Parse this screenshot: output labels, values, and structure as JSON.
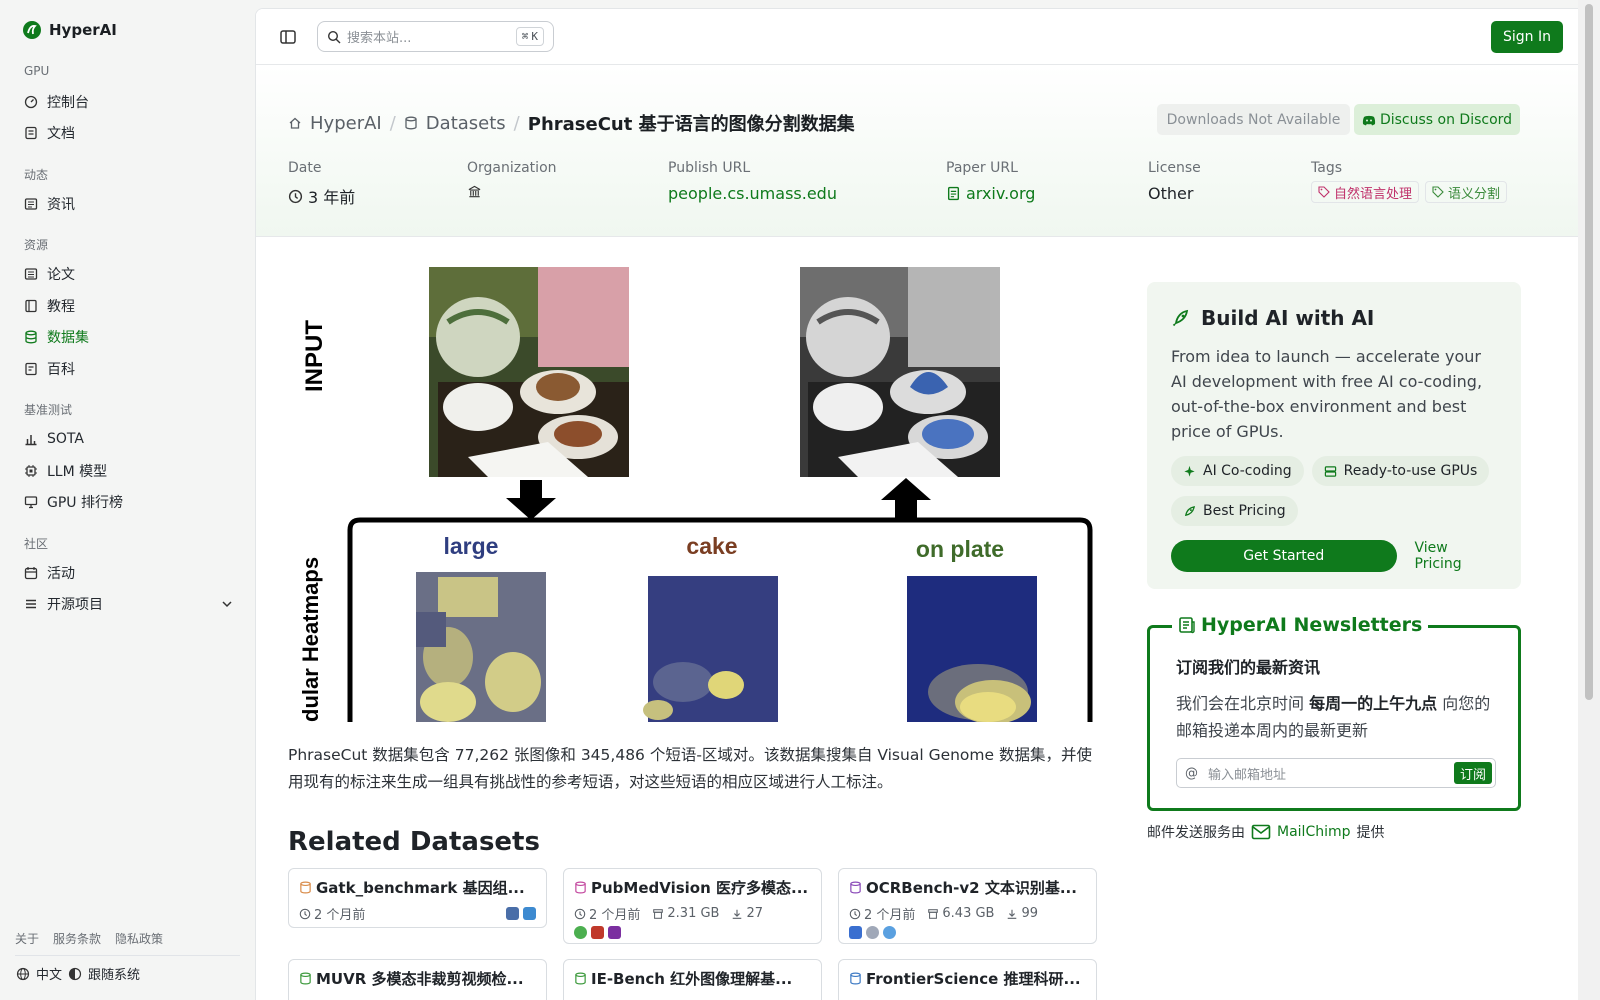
{
  "brand": {
    "name": "HyperAI"
  },
  "sidebar": {
    "sections": [
      {
        "title": "GPU",
        "items": [
          {
            "label": "控制台",
            "icon": "dashboard-icon"
          },
          {
            "label": "文档",
            "icon": "doc-icon"
          }
        ]
      },
      {
        "title": "动态",
        "items": [
          {
            "label": "资讯",
            "icon": "news-icon"
          }
        ]
      },
      {
        "title": "资源",
        "items": [
          {
            "label": "论文",
            "icon": "paper-icon"
          },
          {
            "label": "教程",
            "icon": "book-icon"
          },
          {
            "label": "数据集",
            "icon": "database-icon",
            "active": true
          },
          {
            "label": "百科",
            "icon": "wiki-icon"
          }
        ]
      },
      {
        "title": "基准测试",
        "items": [
          {
            "label": "SOTA",
            "icon": "chart-icon"
          },
          {
            "label": "LLM 模型",
            "icon": "chip-icon"
          },
          {
            "label": "GPU 排行榜",
            "icon": "monitor-icon"
          }
        ]
      },
      {
        "title": "社区",
        "items": [
          {
            "label": "活动",
            "icon": "event-icon"
          },
          {
            "label": "开源项目",
            "icon": "list-icon"
          }
        ]
      }
    ],
    "footer_links": [
      "关于",
      "服务条款",
      "隐私政策"
    ],
    "language": "中文",
    "tracking": "跟随系统"
  },
  "topbar": {
    "search_placeholder": "搜索本站...",
    "shortcut": "K",
    "signin": "Sign In"
  },
  "header": {
    "breadcrumbs": [
      "HyperAI",
      "Datasets"
    ],
    "title_en": "PhraseCut",
    "title_cn": "基于语言的图像分割数据集",
    "downloads": "Downloads Not Available",
    "discord": "Discuss on Discord",
    "meta": {
      "date_label": "Date",
      "date_value": "3 年前",
      "org_label": "Organization",
      "publish_label": "Publish URL",
      "publish_value": "people.cs.umass.edu",
      "paper_label": "Paper URL",
      "paper_value": "arxiv.org",
      "license_label": "License",
      "license_value": "Other",
      "tags_label": "Tags",
      "tags": [
        "自然语言处理",
        "语义分割"
      ]
    }
  },
  "figure": {
    "input_label": "INPUT",
    "heatmaps_label": "dular Heatmaps",
    "words": [
      "large",
      "cake",
      "on plate"
    ]
  },
  "description": "PhraseCut 数据集包含 77,262 张图像和 345,486 个短语-区域对。该数据集搜集自 Visual Genome 数据集，并使用现有的标注来生成一组具有挑战性的参考短语，对这些短语的相应区域进行人工标注。",
  "related": {
    "title": "Related Datasets",
    "cards": [
      {
        "title": "Gatk_benchmark 基因组...",
        "time": "2 个月前",
        "size": "",
        "downloads": "",
        "icon_color": "#d98c4a"
      },
      {
        "title": "PubMedVision 医疗多模态...",
        "time": "2 个月前",
        "size": "2.31 GB",
        "downloads": "27",
        "icon_color": "#c44aa0"
      },
      {
        "title": "OCRBench-v2 文本识别基...",
        "time": "2 个月前",
        "size": "6.43 GB",
        "downloads": "99",
        "icon_color": "#8a4ab8"
      },
      {
        "title": "MUVR 多模态非裁剪视频检...",
        "time": "",
        "size": "",
        "downloads": "",
        "icon_color": "#3d9a3d"
      },
      {
        "title": "IE-Bench 红外图像理解基...",
        "time": "",
        "size": "",
        "downloads": "",
        "icon_color": "#3d9a3d"
      },
      {
        "title": "FrontierScience 推理科研...",
        "time": "",
        "size": "",
        "downloads": "",
        "icon_color": "#3d7ac4"
      }
    ]
  },
  "build": {
    "title": "Build AI with AI",
    "text": "From idea to launch — accelerate your AI development with free AI co-coding, out-of-the-box environment and best price of GPUs.",
    "chips": [
      "AI Co-coding",
      "Ready-to-use GPUs",
      "Best Pricing"
    ],
    "cta": "Get Started",
    "pricing": "View Pricing"
  },
  "newsletter": {
    "legend": "HyperAI Newsletters",
    "heading": "订阅我们的最新资讯",
    "text_a": "我们会在北京时间 ",
    "text_b": "每周一的上午九点",
    "text_c": " 向您的邮箱投递本周内的最新更新",
    "email_placeholder": "输入邮箱地址",
    "subscribe": "订阅",
    "provider_prefix": "邮件发送服务由",
    "provider": "MailChimp",
    "provider_suffix": "提供"
  },
  "colors": {
    "accent": "#0f7a1c",
    "tag_pink": "#c0306a",
    "tag_green": "#3a8a3a"
  }
}
